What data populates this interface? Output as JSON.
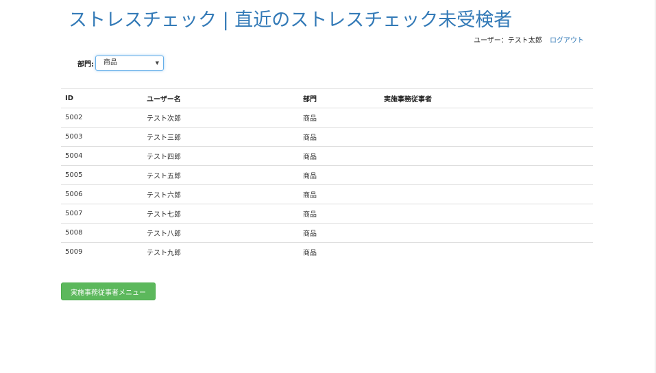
{
  "header": {
    "title": "ストレスチェック | 直近のストレスチェック未受検者",
    "user_label": "ユーザー：テスト太郎",
    "logout_label": "ログアウト"
  },
  "filter": {
    "label": "部門:",
    "selected": "商品"
  },
  "table": {
    "headers": {
      "id": "ID",
      "name": "ユーザー名",
      "dept": "部門",
      "practitioner": "実施事務従事者"
    },
    "rows": [
      {
        "id": "5002",
        "name": "テスト次郎",
        "dept": "商品",
        "practitioner": ""
      },
      {
        "id": "5003",
        "name": "テスト三郎",
        "dept": "商品",
        "practitioner": ""
      },
      {
        "id": "5004",
        "name": "テスト四郎",
        "dept": "商品",
        "practitioner": ""
      },
      {
        "id": "5005",
        "name": "テスト五郎",
        "dept": "商品",
        "practitioner": ""
      },
      {
        "id": "5006",
        "name": "テスト六郎",
        "dept": "商品",
        "practitioner": ""
      },
      {
        "id": "5007",
        "name": "テスト七郎",
        "dept": "商品",
        "practitioner": ""
      },
      {
        "id": "5008",
        "name": "テスト八郎",
        "dept": "商品",
        "practitioner": ""
      },
      {
        "id": "5009",
        "name": "テスト九郎",
        "dept": "商品",
        "practitioner": ""
      }
    ]
  },
  "footer": {
    "menu_button_label": "実施事務従事者メニュー"
  },
  "colors": {
    "title": "#337ab7",
    "link": "#337ab7",
    "button": "#5cb85c"
  }
}
